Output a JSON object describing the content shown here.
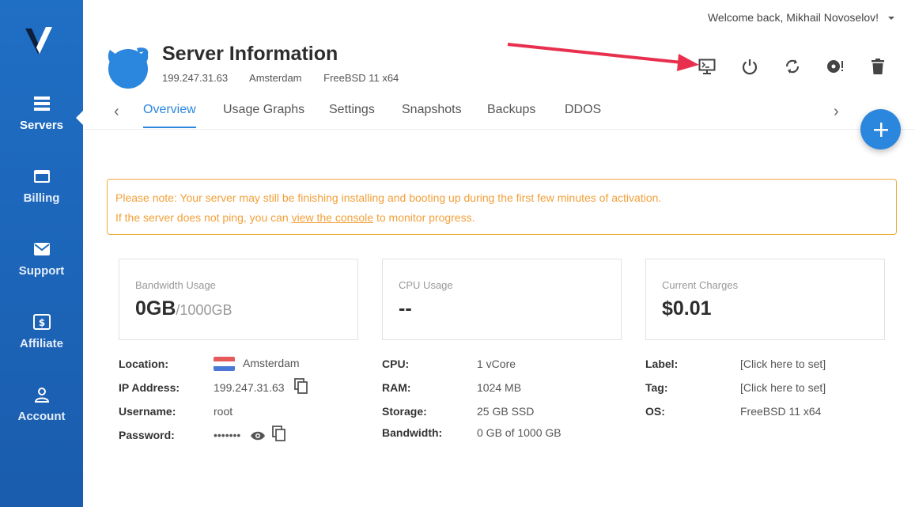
{
  "sidebar": {
    "items": [
      {
        "label": "Servers",
        "icon": "servers-icon",
        "active": true
      },
      {
        "label": "Billing",
        "icon": "billing-icon",
        "active": false
      },
      {
        "label": "Support",
        "icon": "support-icon",
        "active": false
      },
      {
        "label": "Affiliate",
        "icon": "affiliate-icon",
        "active": false
      },
      {
        "label": "Account",
        "icon": "account-icon",
        "active": false
      }
    ]
  },
  "header": {
    "welcome": "Welcome back, Mikhail Novoselov!",
    "title": "Server Information",
    "ip": "199.247.31.63",
    "location": "Amsterdam",
    "os": "FreeBSD 11 x64"
  },
  "actions": [
    "console-icon",
    "power-icon",
    "restart-icon",
    "reinstall-icon",
    "trash-icon"
  ],
  "tabs": [
    "Overview",
    "Usage Graphs",
    "Settings",
    "Snapshots",
    "Backups",
    "DDOS"
  ],
  "notice": {
    "line1": "Please note: Your server may still be finishing installing and booting up during the first few minutes of activation.",
    "line2_before": "If the server does not ping, you can ",
    "line2_link": "view the console",
    "line2_after": " to monitor progress."
  },
  "cards": [
    {
      "label": "Bandwidth Usage",
      "value": "0GB",
      "suffix": "/1000GB"
    },
    {
      "label": "CPU Usage",
      "value": "--",
      "suffix": ""
    },
    {
      "label": "Current Charges",
      "value": "$0.01",
      "suffix": ""
    }
  ],
  "details": {
    "col1": [
      {
        "key": "Location:",
        "value": "Amsterdam"
      },
      {
        "key": "IP Address:",
        "value": "199.247.31.63"
      },
      {
        "key": "Username:",
        "value": "root"
      },
      {
        "key": "Password:",
        "value": "•••••••"
      }
    ],
    "col2": [
      {
        "key": "CPU:",
        "value": "1 vCore"
      },
      {
        "key": "RAM:",
        "value": "1024 MB"
      },
      {
        "key": "Storage:",
        "value": "25 GB SSD"
      },
      {
        "key": "Bandwidth:",
        "value": "0 GB of 1000 GB"
      }
    ],
    "col3": [
      {
        "key": "Label:",
        "value": "[Click here to set]"
      },
      {
        "key": "Tag:",
        "value": "[Click here to set]"
      },
      {
        "key": "OS:",
        "value": "FreeBSD 11 x64"
      }
    ]
  },
  "colors": {
    "accent": "#2b86dd",
    "sidebar": "#1f6fc5",
    "notice": "#f2a03a",
    "arrow": "#e8304e"
  }
}
